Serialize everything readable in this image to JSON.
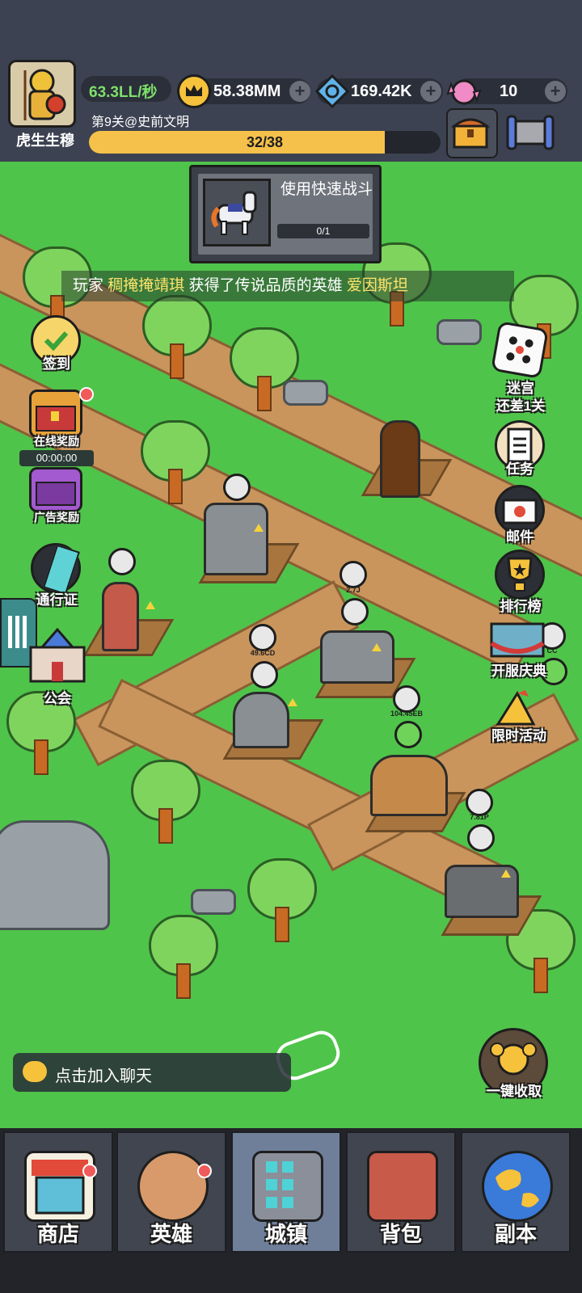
{
  "player": {
    "name": "虎生生穆",
    "income": "63.3LL/秒",
    "stage": "第9关@史前文明",
    "progress_text": "32/38",
    "progress": 0.842
  },
  "currencies": {
    "gold": "58.38MM",
    "gems": "169.42K",
    "candy": "10"
  },
  "quest": {
    "title": "使用快速战斗",
    "progress_text": "0/1"
  },
  "ticker": {
    "prefix": "玩家",
    "player": "稠掩掩靖琪",
    "middle": "获得了传说品质的英雄",
    "hero": "爱因斯坦"
  },
  "left_menu": {
    "signin": "签到",
    "online_reward": "在线奖励",
    "online_timer": "00:00:00",
    "ad_reward": "广告奖励",
    "pass": "通行证",
    "guild": "公会"
  },
  "right_menu": {
    "maze": "迷宫",
    "maze_sub": "还差1关",
    "tasks": "任务",
    "mail": "邮件",
    "ranking": "排行榜",
    "opening": "开服庆典",
    "limited": "限时活动"
  },
  "chat": {
    "placeholder": "点击加入聊天"
  },
  "collect_all": "一键收取",
  "nav": [
    {
      "label": "商店"
    },
    {
      "label": "英雄"
    },
    {
      "label": "城镇"
    },
    {
      "label": "背包"
    },
    {
      "label": "副本"
    }
  ],
  "map_labels": {
    "b1": "2.7J",
    "b2": "49.6CD",
    "b3": "104.45EB",
    "b4": "7.81P",
    "b5": "CC"
  },
  "colors": {
    "grass": "#4fc44a",
    "path": "#c9955c",
    "gold_bar": "#f6c14b",
    "panel": "#3c4252",
    "income_green": "#7ee06a"
  }
}
